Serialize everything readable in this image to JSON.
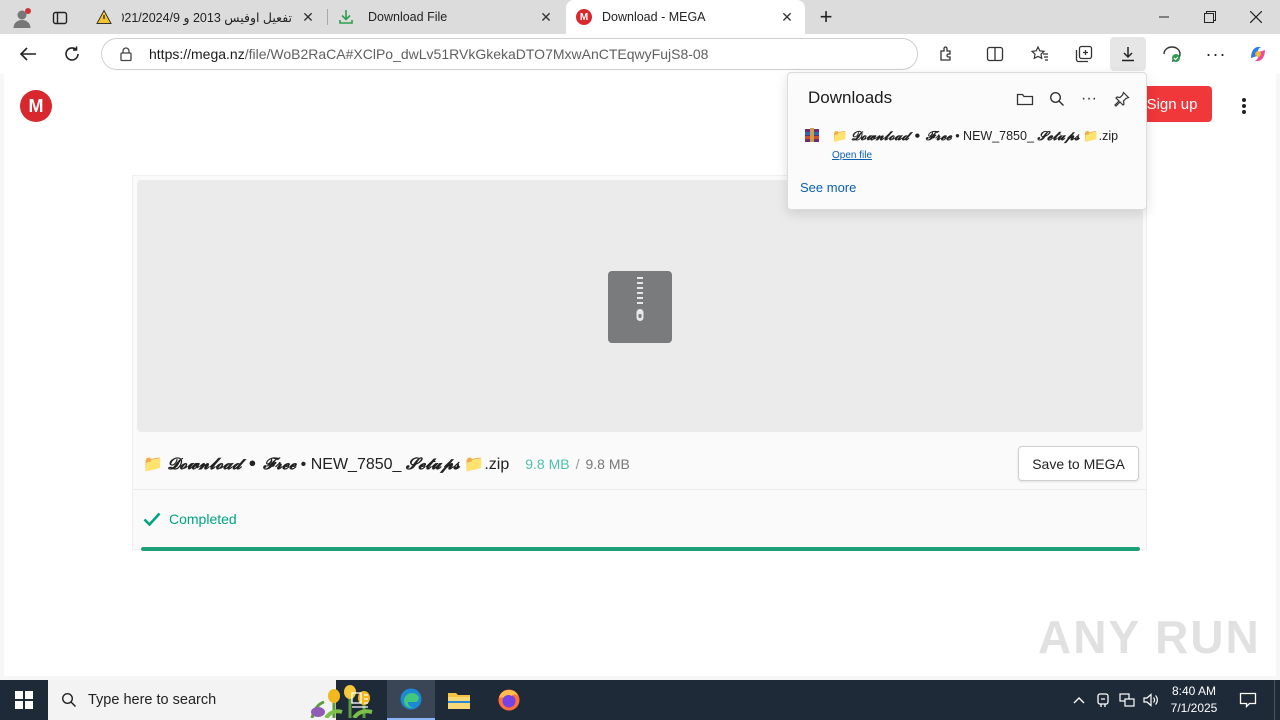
{
  "browser": {
    "tabs": [
      {
        "title": "تفعيل اوفيس 2013 و 2021/2024/9",
        "icon": "warning-triangle-icon"
      },
      {
        "title": "Download File",
        "icon": "download-icon"
      },
      {
        "title": "Download - MEGA",
        "icon": "mega-icon"
      }
    ],
    "url_host": "https://mega.nz",
    "url_path": "/file/WoB2RaCA#XClPo_dwLv51RVkGkekaDTO7MxwAnCTEqwyFujS8-08"
  },
  "mega": {
    "logo_letter": "M",
    "signup_label": "Sign up",
    "file_name_prefix": "📁 ",
    "file_name_styled": "𝓓𝓸𝔀𝓷𝓵𝓸𝓪𝓭 • 𝓕𝓻𝓮𝓮",
    "file_name_mid": " • NEW_7850_ ",
    "file_name_styled2": "𝓢𝓮𝓽𝓾𝓹𝓼",
    "file_name_suffix": " 📁.zip",
    "downloaded_size": "9.8 MB",
    "separator": "/",
    "total_size": "9.8 MB",
    "save_label": "Save to MEGA",
    "status_text": "Completed",
    "progress": 1.0,
    "accent_color": "#d9272e",
    "success_color": "#00a382"
  },
  "downloads": {
    "title": "Downloads",
    "item_name_prefix": "📁 ",
    "item_name_styled": "𝓓𝓸𝔀𝓷𝓵𝓸𝓪𝓭 • 𝓕𝓻𝓮𝓮",
    "item_name_mid": " • NEW_7850_ ",
    "item_name_styled2": "𝓢𝓮𝓽𝓾𝓹𝓼",
    "item_name_suffix": " 📁.zip",
    "open_file": "Open file",
    "see_more": "See more"
  },
  "watermark": "ANY RUN",
  "taskbar": {
    "search_placeholder": "Type here to search",
    "time": "8:40 AM",
    "date": "7/1/2025"
  }
}
